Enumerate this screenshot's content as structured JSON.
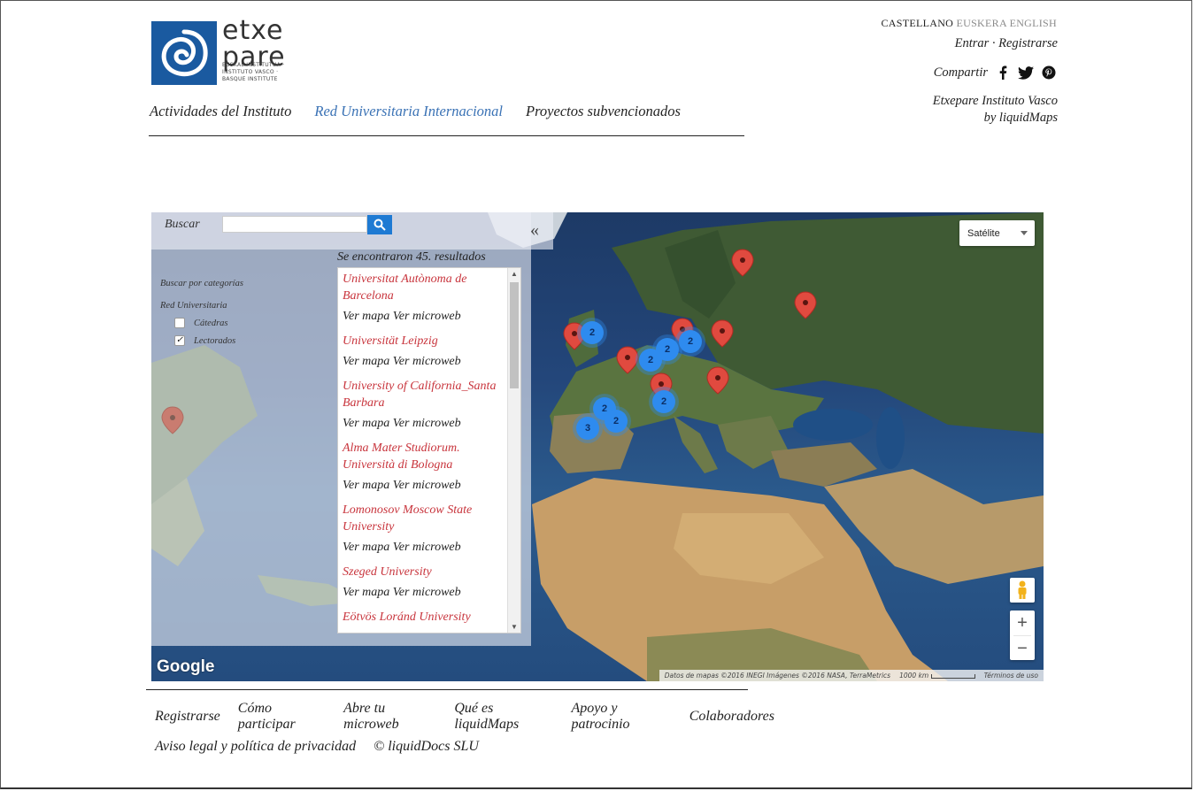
{
  "logo": {
    "name": "etxe pare",
    "sub": "EUSKAL INSTITUTUA · INSTITUTO VASCO · BASQUE INSTITUTE"
  },
  "nav": {
    "items": [
      {
        "label": "Actividades del Instituto",
        "active": false
      },
      {
        "label": "Red Universitaria Internacional",
        "active": true
      },
      {
        "label": "Proyectos subvencionados",
        "active": false
      }
    ]
  },
  "languages": {
    "current": "CASTELLANO",
    "others": [
      "EUSKERA",
      "ENGLISH"
    ]
  },
  "auth": {
    "login": "Entrar",
    "separator": "·",
    "register": "Registrarse"
  },
  "share": {
    "label": "Compartir",
    "icons": [
      "facebook-icon",
      "twitter-icon",
      "pinterest-icon"
    ]
  },
  "credit": {
    "line1": "Etxepare Instituto Vasco",
    "line2": "by liquidMaps"
  },
  "map": {
    "search": {
      "label": "Buscar",
      "value": "",
      "placeholder": ""
    },
    "collapse_icon": "«",
    "categories": {
      "title": "Buscar por categorías",
      "group": "Red Universitaria",
      "options": [
        {
          "label": "Cátedras",
          "checked": false
        },
        {
          "label": "Lectorados",
          "checked": true
        }
      ]
    },
    "results": {
      "count_text": "Se encontraron 45. resultados",
      "link_map": "Ver mapa",
      "link_microweb": "Ver microweb",
      "items": [
        {
          "title": "Universitat Autònoma de Barcelona"
        },
        {
          "title": "Universität Leipzig"
        },
        {
          "title": "University of California_Santa Barbara"
        },
        {
          "title": "Alma Mater Studiorum. Università di Bologna"
        },
        {
          "title": "Lomonosov Moscow State University"
        },
        {
          "title": "Szeged University"
        },
        {
          "title": "Eötvös Loránd University"
        }
      ]
    },
    "map_type": "Satélite",
    "clusters": [
      "2",
      "2",
      "2",
      "2",
      "2",
      "2",
      "3",
      "2"
    ],
    "zoom": {
      "in": "+",
      "out": "−"
    },
    "google_logo": "Google",
    "attribution": "Datos de mapas ©2016 INEGI Imágenes ©2016 NASA, TerraMetrics",
    "scale": "1000 km",
    "terms": "Términos de uso",
    "colors": {
      "marker": "#e04a3f",
      "cluster": "#2e8bef",
      "result_title": "#c8343c"
    }
  },
  "footer": {
    "row1": [
      "Registrarse",
      "Cómo participar",
      "Abre tu microweb",
      "Qué es liquidMaps",
      "Apoyo y patrocinio",
      "Colaboradores"
    ],
    "row2": [
      "Aviso legal y política de privacidad",
      "© liquidDocs SLU"
    ]
  }
}
